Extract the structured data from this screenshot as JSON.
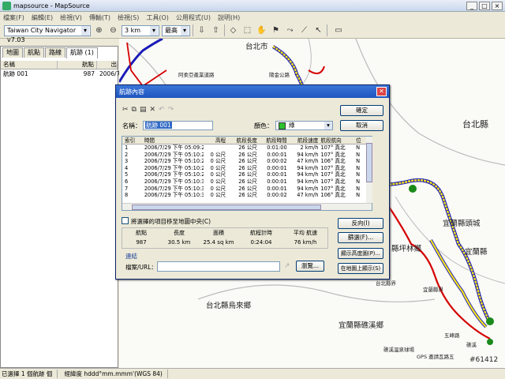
{
  "window": {
    "title": "mapsource - MapSource",
    "min": "_",
    "max": "□",
    "close": "×"
  },
  "menu": [
    "檔案(F)",
    "編輯(E)",
    "檢視(V)",
    "傳輸(T)",
    "檢視(S)",
    "工具(O)",
    "公用程式(U)",
    "說明(H)"
  ],
  "toolbar": {
    "map_product": "Taiwan City Navigator v7.03",
    "zoom_scale": "3 km",
    "detail": "最高"
  },
  "left_panel": {
    "tabs": [
      "地圖",
      "航點",
      "路線",
      "航跡 (1)"
    ],
    "active_tab": 3,
    "columns": [
      "名稱",
      "航點",
      "出"
    ],
    "rows": [
      {
        "name": "航跡 001",
        "points": "987",
        "date": "2006/7/"
      }
    ]
  },
  "map": {
    "labels": {
      "dist_taipei_1": "台北市",
      "road_yangjin": "陽金公路",
      "road_ahuang": "阿柔亞產業道路",
      "county_taipei_1": "台北縣",
      "county_yilan_1": "宜蘭縣頭城",
      "county_yilan_2": "宜蘭縣",
      "lbl_linkou": "縣坪林鄉",
      "lbl_taipei_2": "台北縣界",
      "lbl_yilan_jie": "宜蘭縣界",
      "lbl_wulai": "台北縣烏來鄉",
      "lbl_datong": "宜蘭縣礁溪鄉",
      "lbl_wufeng": "五峰路",
      "lbl_road5": "礁溪溫泉球場",
      "lbl_gps": "GPS 邀請瓦路五",
      "lbl_linkou2": "礁溪"
    }
  },
  "dialog": {
    "title": "航跡內容",
    "ok": "確定",
    "cancel": "取消",
    "name_label": "名稱：",
    "name_value": "航跡 001",
    "color_label": "顏色：",
    "color_value": "綠",
    "columns": [
      "索引",
      "時間",
      "高程",
      "航段長度",
      "航段時間",
      "航段速度",
      "航段航向",
      "位"
    ],
    "rows": [
      [
        "1",
        "2006/7/29 下午 05:09:25",
        "",
        "26 公尺",
        "0:01:00",
        "2 km/h",
        "107° 真北",
        "N"
      ],
      [
        "2",
        "2006/7/29 下午 05:10:25",
        "0 公尺",
        "26 公尺",
        "0:00:01",
        "94 km/h",
        "107° 真北",
        "N"
      ],
      [
        "3",
        "2006/7/29 下午 05:10:26",
        "0 公尺",
        "26 公尺",
        "0:00:02",
        "47 km/h",
        "106° 真北",
        "N"
      ],
      [
        "4",
        "2006/7/29 下午 05:10:28",
        "0 公尺",
        "26 公尺",
        "0:00:01",
        "94 km/h",
        "107° 真北",
        "N"
      ],
      [
        "5",
        "2006/7/29 下午 05:10:29",
        "0 公尺",
        "26 公尺",
        "0:00:01",
        "94 km/h",
        "107° 真北",
        "N"
      ],
      [
        "6",
        "2006/7/29 下午 05:10:30",
        "0 公尺",
        "26 公尺",
        "0:00:01",
        "94 km/h",
        "107° 真北",
        "N"
      ],
      [
        "7",
        "2006/7/29 下午 05:10:31",
        "0 公尺",
        "26 公尺",
        "0:00:01",
        "94 km/h",
        "107° 真北",
        "N"
      ],
      [
        "8",
        "2006/7/29 下午 05:10:32",
        "0 公尺",
        "26 公尺",
        "0:00:02",
        "47 km/h",
        "106° 真北",
        "N"
      ]
    ],
    "center_check": "將選擇的項目移至地圖中央(C)",
    "reverse": "反向(I)",
    "filter": "篩選(F)...",
    "show_profile": "顯示高度圖(P)...",
    "show_on_map": "在地圖上顯示(S)",
    "stats_headers": [
      "航點",
      "長度",
      "面積",
      "航程計時",
      "平均 航速"
    ],
    "stats_values": [
      "987",
      "30.5 km",
      "25.4 sq km",
      "0:24:04",
      "76 km/h"
    ],
    "link_label": "連結",
    "file_url_label": "檔案/URL：",
    "browse": "瀏覽..."
  },
  "status": {
    "selection": "已選擇 1 個航跡 個",
    "coords": "經緯度 hddd°mm.mmm'(WGS 84)"
  },
  "watermark": "#61412",
  "colors": {
    "track_yellow": "#f5e51a",
    "track_red": "#d40000",
    "route_blue": "#1a1ab8",
    "green_point": "#1a8a1a"
  }
}
